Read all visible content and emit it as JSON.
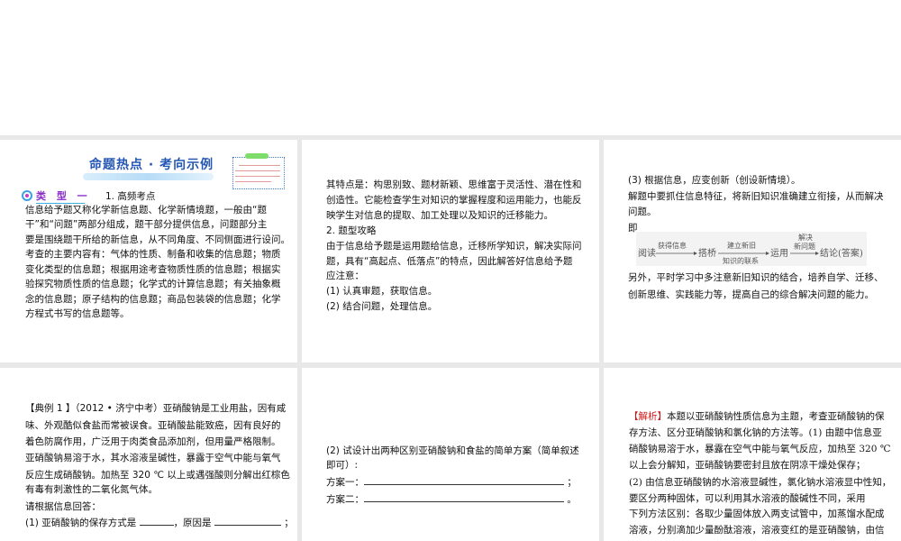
{
  "slides": {
    "s1": {
      "title": "命题热点 · 考向示例",
      "type_label": "类 型 一",
      "heading": "1. 高频考点",
      "lines": [
        "信息给予题又称化学新信息题、化学新情境题，一般由“题",
        "干”和“问题”两部分组成，题干部分提供信息，问题部分主",
        "要是围绕题干所给的新信息，从不同角度、不同侧面进行设问。",
        "考查的主要内容有：气体的性质、制备和收集的信息题；物质",
        "变化类型的信息题；根据用途考查物质性质的信息题；根据实",
        "验探究物质性质的信息题；化学式的计算信息题；有关抽象概",
        "念的信息题；原子结构的信息题；商品包装袋的信息题；化学",
        "方程式书写的信息题等。"
      ]
    },
    "s2": {
      "lines": [
        "其特点是：构思别致、题材新颖、思维富于灵活性、潜在性和",
        "创造性。它能检查学生对知识的掌握程度和运用能力，也能反",
        "映学生对信息的提取、加工处理以及知识的迁移能力。",
        "2. 题型攻略",
        "由于信息给予题是运用题给信息，迁移所学知识，解决实际问",
        "题，具有“高起点、低落点”的特点，因此解答好信息给予题",
        "应注意：",
        "(1) 认真审题，获取信息。",
        "(2) 结合问题，处理信息。"
      ]
    },
    "s3": {
      "lines_top": [
        "(3) 根据信息，应变创新（创设新情境）。",
        "解题中要抓住信息特征，将新旧知识准确建立衔接，从而解决",
        "问题。",
        "即"
      ],
      "flow": {
        "n1": "阅读",
        "a1": "获得信息",
        "n2": "搭桥",
        "a2_top": "建立新旧",
        "a2_bottom": "知识的联系",
        "n3": "运用",
        "a3_top": "解决",
        "a3_mid": "新问题",
        "n4": "结论(答案)"
      },
      "lines_bottom": [
        "另外，平时学习中多注意新旧知识的结合，培养自学、迁移、",
        "创新思维、实践能力等，提高自己的综合解决问题的能力。"
      ]
    },
    "s4": {
      "lines": [
        "【典例 1 】（2012 • 济宁中考）亚硝酸钠是工业用盐，因有咸",
        "味、外观酷似食盐而常被误食。亚硝酸盐能致癌，因有良好的",
        "着色防腐作用，广泛用于肉类食品添加剂，但用量严格限制。",
        "亚硝酸钠易溶于水，其水溶液呈碱性，暴露于空气中能与氧气",
        "反应生成硝酸钠。加热至 320 ℃ 以上或遇强酸则分解出红棕色",
        "有毒有刺激性的二氧化氮气体。",
        "请根据信息回答："
      ],
      "q1_a": "(1) 亚硝酸钠的保存方式是",
      "q1_b": "，原因是",
      "q1_end": "；"
    },
    "s5": {
      "lines": [
        "(2) 试设计出两种区别亚硝酸钠和食盐的简单方案（简单叙述",
        "即可）:"
      ],
      "plan1": "方案一：",
      "plan1_end": "；",
      "plan2": "方案二：",
      "plan2_end": "。"
    },
    "s6": {
      "tag": "【解析】",
      "first": "本题以亚硝酸钠性质信息为主题，考查亚硝酸钠的保",
      "lines": [
        "存方法、区分亚硝酸钠和氯化钠的方法等。(1) 由题中信息亚",
        "硝酸钠易溶于水，暴露在空气中能与氧气反应，加热至 320 ℃",
        "以上会分解知，亚硝酸钠要密封且放在阴凉干燥处保存；",
        "(2) 由信息亚硝酸钠的水溶液显碱性，氯化钠水溶液显中性知，",
        "要区分两种固体，可以利用其水溶液的酸碱性不同，采用",
        "下列方法区别：各取少量固体放入两支试管中，加蒸馏水配成",
        "溶液，分别滴加少量酚酞溶液，溶液变红的是亚硝酸钠，由信"
      ]
    }
  },
  "colors": {
    "sorter_bg": "#e8e8e8",
    "title_blue": "#2456b4",
    "type_purple": "#8a2fc8",
    "analysis_red": "#d01818"
  }
}
